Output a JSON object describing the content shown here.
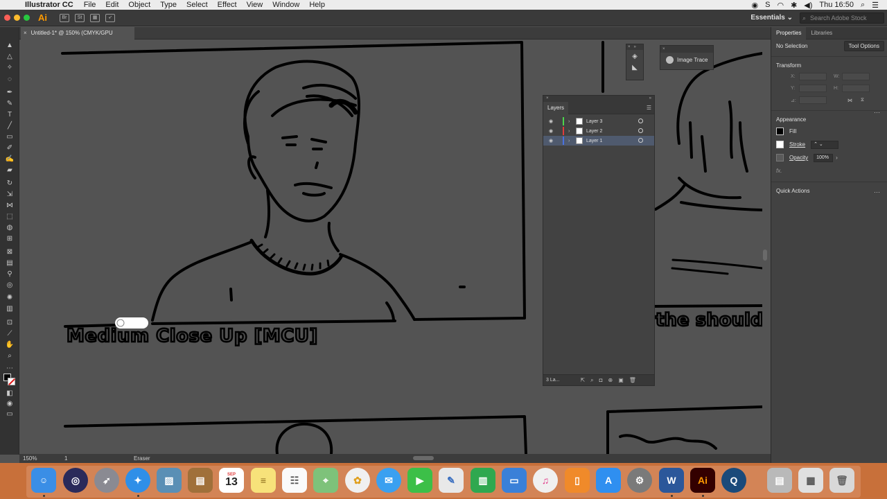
{
  "menubar": {
    "app_name": "Illustrator CC",
    "items": [
      "File",
      "Edit",
      "Object",
      "Type",
      "Select",
      "Effect",
      "View",
      "Window",
      "Help"
    ],
    "clock": "Thu 16:50"
  },
  "appbar": {
    "logo": "Ai",
    "workspace": "Essentials ⌄",
    "search_placeholder": "Search Adobe Stock"
  },
  "document": {
    "tab_title": "Untitled-1* @ 150% (CMYK/GPU Preview)"
  },
  "canvas": {
    "caption": "Medium Close Up [MCU]",
    "caption_right": "the shoulde"
  },
  "floating": {
    "image_trace_label": "Image Trace"
  },
  "layers_panel": {
    "title": "Layers",
    "layers": [
      {
        "name": "Layer 3",
        "color": "#4cd54c",
        "selected": false
      },
      {
        "name": "Layer 2",
        "color": "#e03c3c",
        "selected": false
      },
      {
        "name": "Layer 1",
        "color": "#4a72e0",
        "selected": true
      }
    ],
    "footer_count": "3 La..."
  },
  "properties": {
    "tabs": [
      "Properties",
      "Libraries"
    ],
    "no_selection": "No Selection",
    "tool_options": "Tool Options",
    "transform_title": "Transform",
    "fields": {
      "x": "X:",
      "y": "Y:",
      "w": "W:",
      "h": "H:",
      "angle": "⊿:"
    },
    "appearance_title": "Appearance",
    "fill": "Fill",
    "stroke": "Stroke",
    "opacity": "Opacity",
    "opacity_value": "100%",
    "fx": "fx.",
    "quick_actions": "Quick Actions"
  },
  "statusbar": {
    "zoom": "150%",
    "page": "1",
    "tool": "Eraser"
  },
  "colors": {
    "accent": "#ff9a00",
    "canvas_bg": "#535353",
    "panel_bg": "#424242",
    "dock_bg": "#c8703a"
  },
  "dock": {
    "calendar_month": "SEP",
    "calendar_day": "13",
    "items": [
      "finder-icon",
      "siri-icon",
      "launchpad-icon",
      "safari-icon",
      "preview-icon",
      "notebook-icon",
      "calendar-icon",
      "notes-icon",
      "reminders-icon",
      "maps-icon",
      "photos-icon",
      "messages-icon",
      "facetime-icon",
      "keynote-icon",
      "numbers-icon",
      "presentation-icon",
      "itunes-icon",
      "ibooks-icon",
      "appstore-icon",
      "system-preferences-icon",
      "word-icon",
      "illustrator-icon",
      "quicktime-icon",
      "downloads-stack-icon",
      "documents-stack-icon",
      "trash-icon"
    ]
  }
}
